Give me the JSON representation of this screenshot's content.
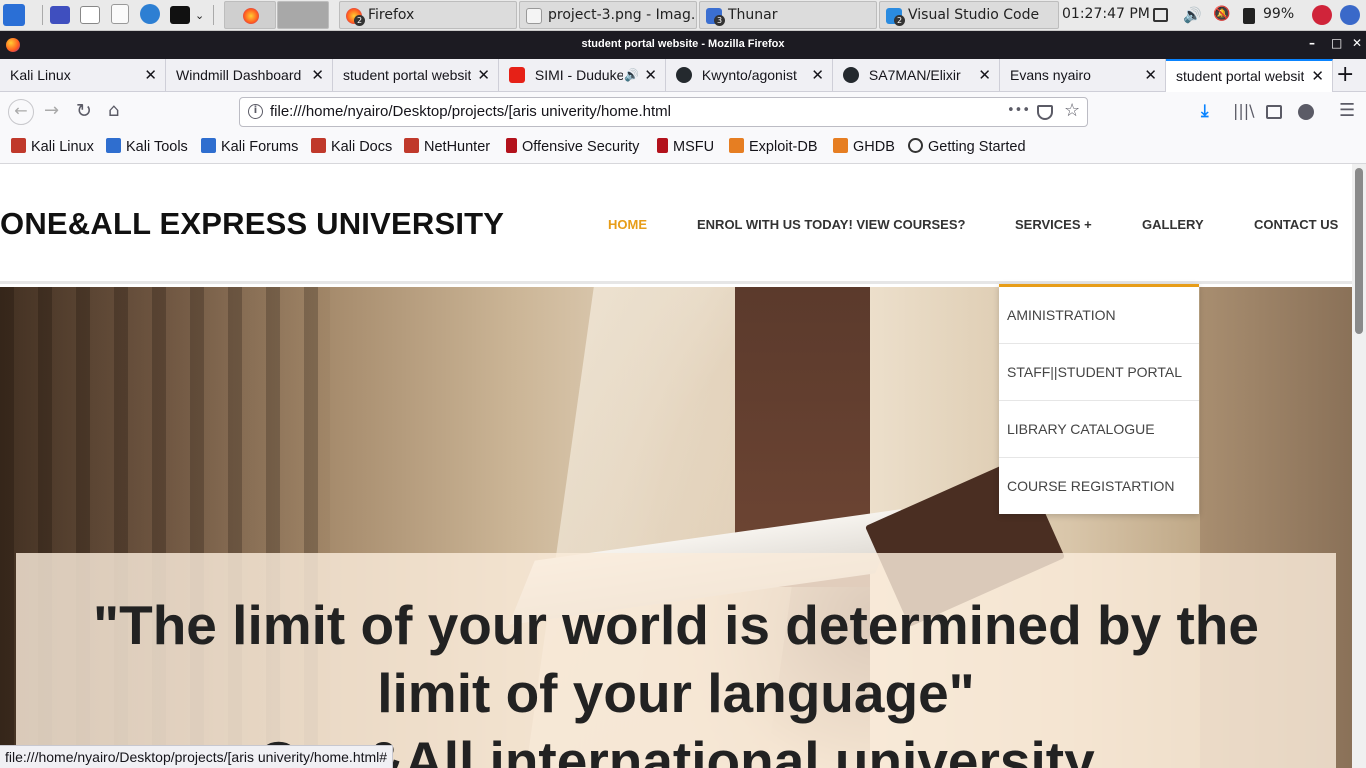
{
  "taskbar": {
    "tasks": [
      {
        "label": "",
        "badge": ""
      },
      {
        "label": "Firefox",
        "badge": "2"
      },
      {
        "label": "project-3.png - Imag...",
        "badge": ""
      },
      {
        "label": "Thunar",
        "badge": "3"
      },
      {
        "label": "Visual Studio Code",
        "badge": "2"
      }
    ],
    "clock": "01:27:47 PM",
    "battery": "99%"
  },
  "window": {
    "title": "student portal website - Mozilla Firefox"
  },
  "tabs": [
    {
      "label": "Kali Linux",
      "active": false
    },
    {
      "label": "Windmill Dashboard",
      "active": false
    },
    {
      "label": "student portal website",
      "active": false
    },
    {
      "label": "SIMI - Duduke",
      "active": false
    },
    {
      "label": "Kwynto/agonist",
      "active": false
    },
    {
      "label": "SA7MAN/Elixir",
      "active": false
    },
    {
      "label": "Evans nyairo",
      "active": false
    },
    {
      "label": "student portal website",
      "active": true
    }
  ],
  "navbar": {
    "url": "file:///home/nyairo/Desktop/projects/[aris univerity/home.html",
    "more": "•••"
  },
  "bookmarks": [
    "Kali Linux",
    "Kali Tools",
    "Kali Forums",
    "Kali Docs",
    "NetHunter",
    "Offensive Security",
    "MSFU",
    "Exploit-DB",
    "GHDB",
    "Getting Started"
  ],
  "site": {
    "brand": "ONE&ALL EXPRESS UNIVERSITY",
    "menu": {
      "home": "HOME",
      "enrol": "ENROL WITH US TODAY! VIEW COURSES?",
      "services": "SERVICES +",
      "gallery": "GALLERY",
      "contact": "CONTACT US"
    },
    "dropdown": [
      "AMINISTRATION",
      "STAFF||STUDENT PORTAL",
      "LIBRARY CATALOGUE",
      "COURSE REGISTARTION"
    ],
    "quote_line1": "\"The limit of your world is determined by the",
    "quote_line2": "limit of your language\"",
    "quote_line3": "One&All international university"
  },
  "status_url": "file:///home/nyairo/Desktop/projects/[aris univerity/home.html#",
  "colors": {
    "accent": "#e79d18",
    "firefox_titlebar": "#1c1b22"
  }
}
